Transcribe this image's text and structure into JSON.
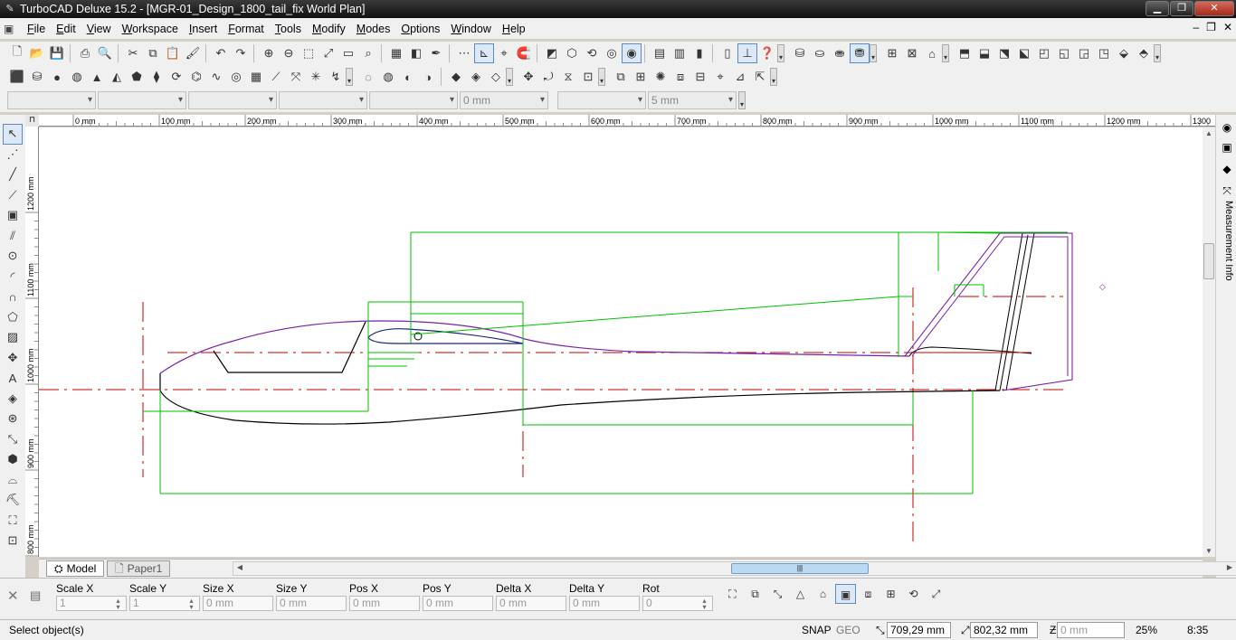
{
  "window": {
    "title": "TurboCAD Deluxe 15.2 - [MGR-01_Design_1800_tail_fix World Plan]",
    "min": "▁",
    "max": "❐",
    "close": "✕"
  },
  "menu": {
    "items": [
      "File",
      "Edit",
      "View",
      "Workspace",
      "Insert",
      "Format",
      "Tools",
      "Modify",
      "Modes",
      "Options",
      "Window",
      "Help"
    ],
    "mdi_min": "–",
    "mdi_restore": "❐",
    "mdi_close": "✕"
  },
  "toolbar3": {
    "combo_values": [
      "",
      "",
      "",
      "",
      "",
      "0 mm",
      "",
      "5 mm"
    ]
  },
  "ruler": {
    "top_labels": [
      "0 mm",
      "100 mm",
      "200 mm",
      "300 mm",
      "400 mm",
      "500 mm",
      "600 mm",
      "700 mm",
      "800 mm",
      "900 mm",
      "1000 mm",
      "1100 mm",
      "1200 mm",
      "1300"
    ],
    "left_labels": [
      "1200 mm",
      "1100 mm",
      "1000 mm",
      "900 mm",
      "800 mm"
    ]
  },
  "side_panel": {
    "label": "Measurement Info"
  },
  "tabs": {
    "model": "Model",
    "paper": "Paper1"
  },
  "inspector": {
    "fields": [
      {
        "label": "Scale X",
        "value": "1"
      },
      {
        "label": "Scale Y",
        "value": "1"
      },
      {
        "label": "Size X",
        "value": "0 mm"
      },
      {
        "label": "Size Y",
        "value": "0 mm"
      },
      {
        "label": "Pos X",
        "value": "0 mm"
      },
      {
        "label": "Pos Y",
        "value": "0 mm"
      },
      {
        "label": "Delta X",
        "value": "0 mm"
      },
      {
        "label": "Delta Y",
        "value": "0 mm"
      },
      {
        "label": "Rot",
        "value": "0"
      }
    ]
  },
  "status": {
    "message": "Select object(s)",
    "snap": "SNAP",
    "geo": "GEO",
    "x_value": "709,29 mm",
    "y_value": "802,32 mm",
    "z_value": "0 mm",
    "zoom": "25%",
    "time": "8:35"
  },
  "colors": {
    "dimension": "#00c000",
    "centerline": "#c00000",
    "outline": "#7a1fa8",
    "ink": "#000000"
  }
}
